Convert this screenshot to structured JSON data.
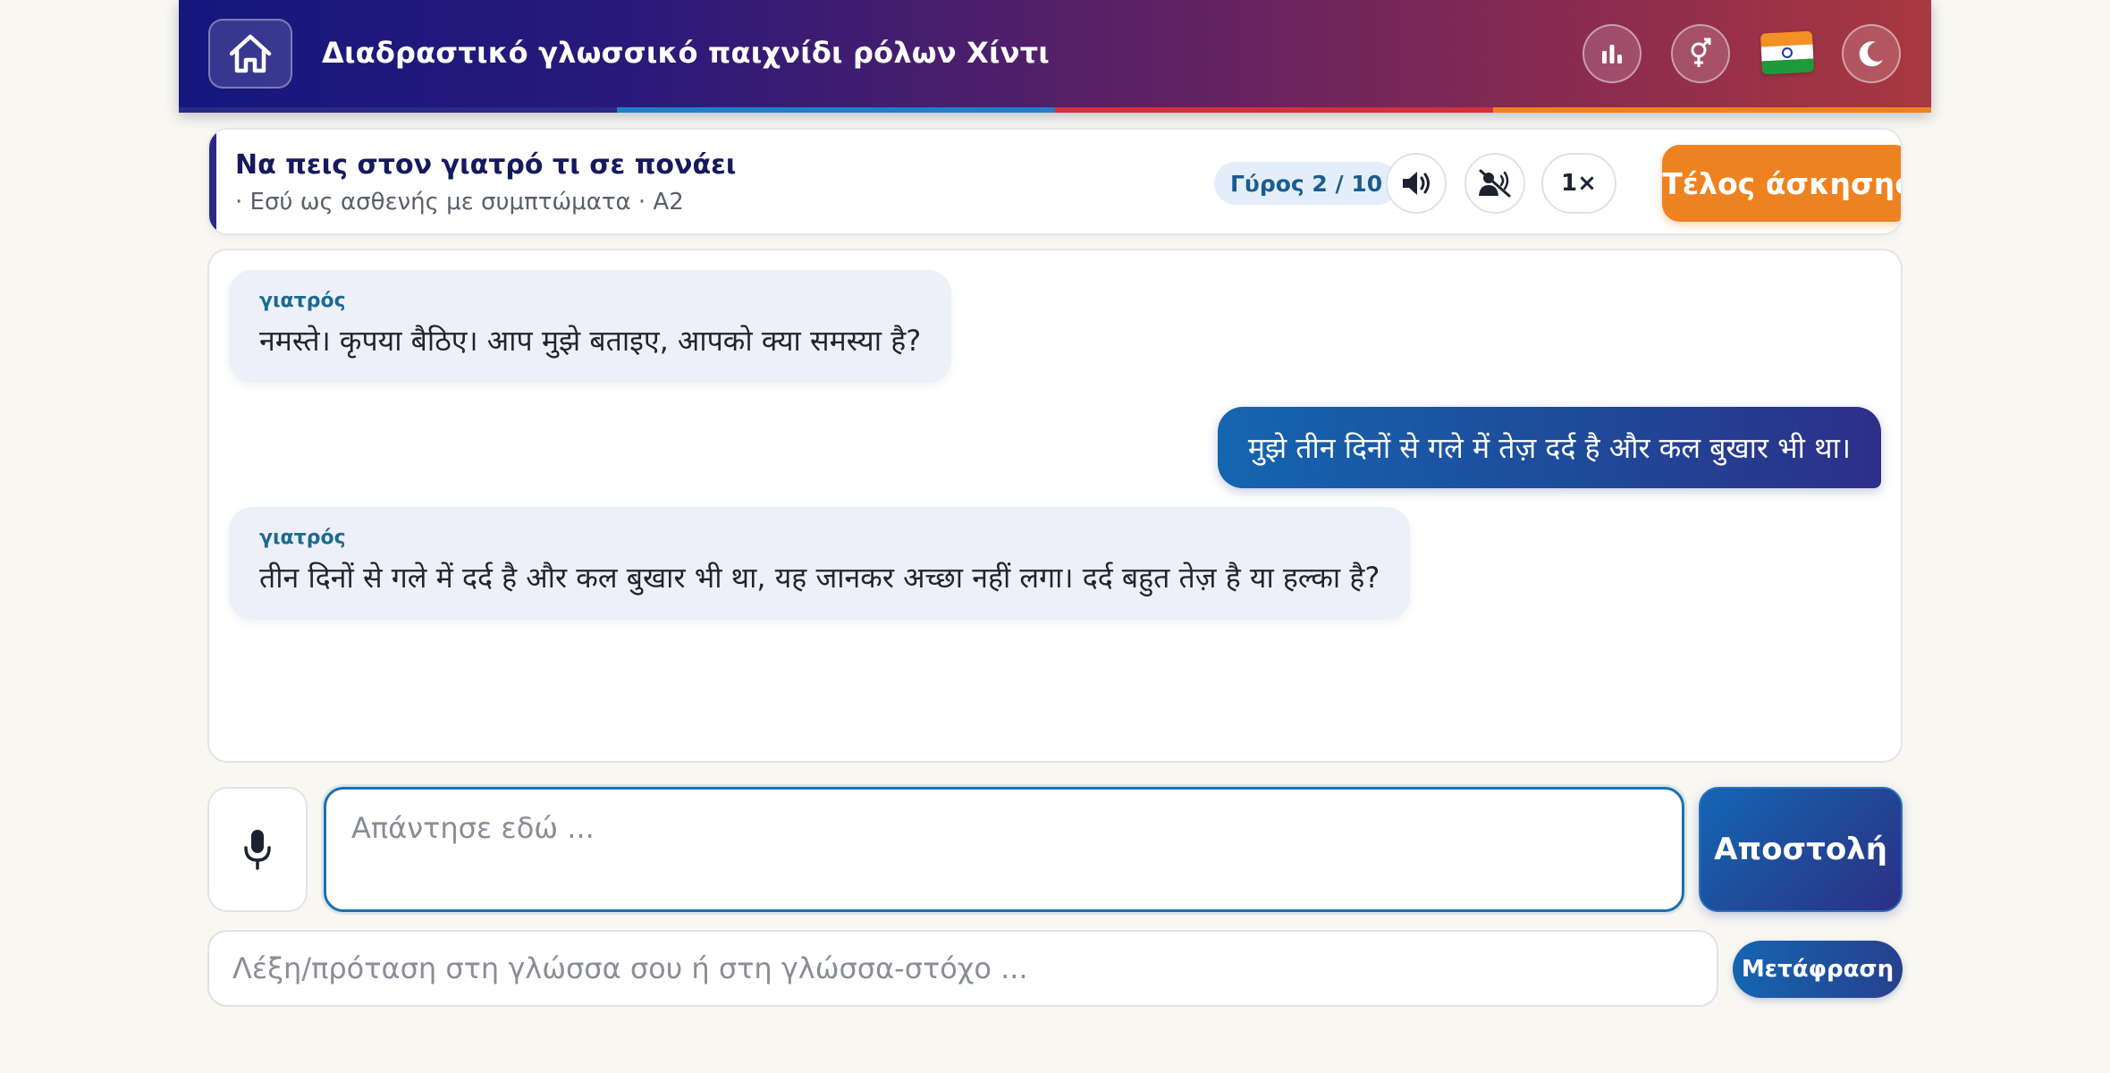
{
  "header": {
    "title": "Διαδραστικό γλωσσικό παιχνίδι ρόλων Χίντι",
    "icons": [
      "home-icon",
      "stats-icon",
      "gender-icon",
      "india-flag-icon",
      "moon-icon"
    ],
    "stripe_colors": [
      "#2a2a86",
      "#1f7fc8",
      "#d3303b",
      "#ef8220"
    ]
  },
  "scenario": {
    "title": "Να πεις στον γιατρό τι σε πονάει",
    "subtitle": "· Εσύ ως ασθενής με συμπτώματα · A2",
    "round": "Γύρος 2 / 10",
    "speed": "1×",
    "end_label": "Τέλος άσκησης"
  },
  "chat": {
    "messages": [
      {
        "from": "other",
        "speaker": "γιατρός",
        "text": "नमस्ते। कृपया बैठिए। आप मुझे बताइए, आपको क्या समस्या है?"
      },
      {
        "from": "me",
        "text": "मुझे तीन दिनों से गले में तेज़ दर्द है और कल बुखार भी था।"
      },
      {
        "from": "other",
        "speaker": "γιατρός",
        "text": "तीन दिनों से गले में दर्द है और कल बुखार भी था, यह जानकर अच्छा नहीं लगा। दर्द बहुत तेज़ है या हल्का है?"
      }
    ]
  },
  "input": {
    "answer_placeholder": "Απάντησε εδώ ...",
    "send_label": "Αποστολή",
    "translate_placeholder": "Λέξη/πρόταση στη γλώσσα σου ή στη γλώσσα-στόχο ...",
    "translate_label": "Μετάφραση"
  },
  "colors": {
    "accent_orange": "#ef8220",
    "accent_blue": "#1565b0",
    "navy": "#2a2a86"
  }
}
